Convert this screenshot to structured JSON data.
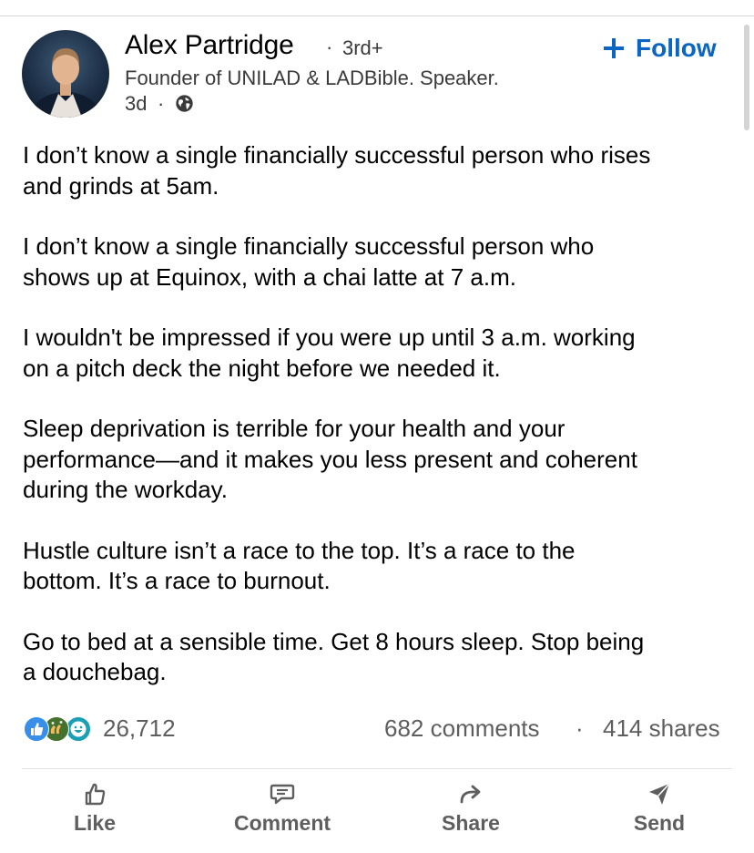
{
  "author": {
    "name": "Alex Partridge",
    "separator": "·",
    "degree": "3rd+",
    "headline": "Founder of UNILAD & LADBible. Speaker.",
    "age": "3d",
    "age_separator": "·"
  },
  "follow": {
    "plus": "+",
    "label": "Follow"
  },
  "post": {
    "paragraphs": [
      "I don’t know a single financially successful person who rises\nand grinds at 5am.",
      "I don’t know a single financially successful person who\nshows up at Equinox, with a chai latte at 7 a.m.",
      "I wouldn't be impressed if you were up until 3 a.m. working\non a pitch deck the night before we needed it.",
      "Sleep deprivation is terrible for your health and your\nperformance—and it makes you less present and coherent\nduring the workday.",
      "Hustle culture isn’t a race to the top. It’s a race to the\nbottom. It’s a race to burnout.",
      "Go to bed at a sensible time. Get 8 hours sleep. Stop being\na douchebag."
    ]
  },
  "stats": {
    "reactions": "26,712",
    "comments": "682 comments",
    "separator": "·",
    "shares": "414 shares"
  },
  "actions": {
    "like": "Like",
    "comment": "Comment",
    "share": "Share",
    "send": "Send"
  },
  "colors": {
    "accent": "#0a66c2",
    "muted_text": "#5e5e5e",
    "like_reaction": "#378fe9",
    "celebrate_reaction": "#44712e",
    "funny_reaction": "#1a9fb5"
  },
  "icons": [
    "globe-icon",
    "plus-icon",
    "like-reaction-icon",
    "celebrate-reaction-icon",
    "funny-reaction-icon",
    "thumbs-up-icon",
    "comment-icon",
    "share-icon",
    "send-icon"
  ]
}
